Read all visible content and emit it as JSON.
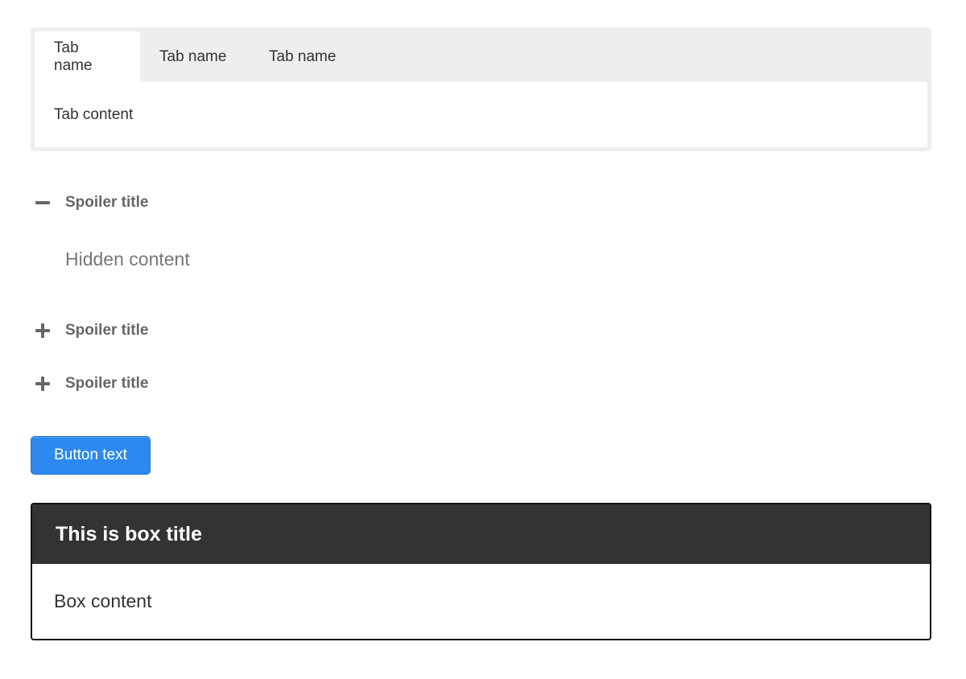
{
  "tabs": {
    "items": [
      {
        "label": "Tab name",
        "active": true
      },
      {
        "label": "Tab name",
        "active": false
      },
      {
        "label": "Tab name",
        "active": false
      }
    ],
    "content": "Tab content"
  },
  "spoilers": [
    {
      "title": "Spoiler title",
      "expanded": true,
      "icon": "minus-icon",
      "content": "Hidden content"
    },
    {
      "title": "Spoiler title",
      "expanded": false,
      "icon": "plus-icon"
    },
    {
      "title": "Spoiler title",
      "expanded": false,
      "icon": "plus-icon"
    }
  ],
  "button": {
    "label": "Button text",
    "color": "#2d89ef"
  },
  "box": {
    "title": "This is box title",
    "content": "Box content",
    "title_bg": "#333333"
  }
}
